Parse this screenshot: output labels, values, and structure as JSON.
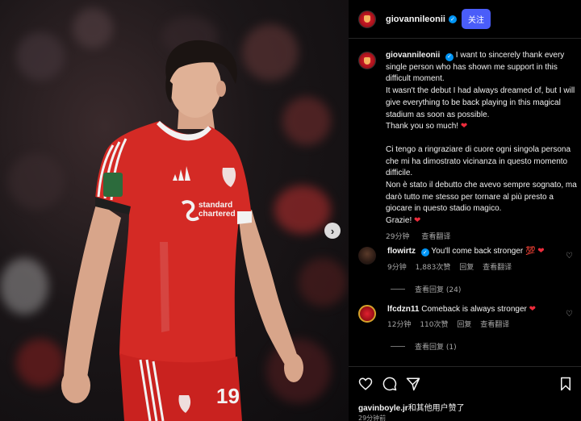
{
  "header": {
    "username": "giovannileonii",
    "follow_label": "关注"
  },
  "post": {
    "username": "giovannileonii",
    "caption_en": [
      "I want to sincerely thank every single person who has shown me support in this difficult moment.",
      "It wasn't the debut I had always dreamed of, but I will give everything to be back playing in this magical stadium as soon as possible.",
      "Thank you so much!"
    ],
    "caption_it": [
      "Ci tengo a ringraziare di cuore ogni singola persona che mi ha dimostrato vicinanza in questo momento difficile.",
      "Non è stato il debutto che avevo sempre sognato, ma darò tutto me stesso per tornare al più presto a giocare in questo stadio magico.",
      "Grazie!"
    ],
    "heart": "❤",
    "time": "29分钟",
    "translate_label": "查看翻译"
  },
  "comments": [
    {
      "username": "flowirtz",
      "text": "You'll come back stronger",
      "emoji": "💯 ❤",
      "time": "9分钟",
      "likes": "1,883次赞",
      "reply_label": "回复",
      "translate_label": "查看翻译",
      "view_replies": "查看回复 (24)"
    },
    {
      "username": "lfcdzn11",
      "text": "Comeback is always stronger",
      "emoji": "❤",
      "time": "12分钟",
      "likes": "110次赞",
      "reply_label": "回复",
      "translate_label": "查看翻译",
      "view_replies": "查看回复 (1)"
    }
  ],
  "footer": {
    "liked_by_user": "gavinboyle.jr",
    "liked_by_rest": "和其他用户赞了",
    "time": "29分钟前"
  },
  "photo": {
    "sponsor_line1": "standard",
    "sponsor_line2": "chartered",
    "shirt_number": "19"
  },
  "colors": {
    "shirt_red": "#d42a25",
    "follow_button": "#4a5df9",
    "verified": "#0095f6",
    "heart": "#ed2c3c"
  }
}
